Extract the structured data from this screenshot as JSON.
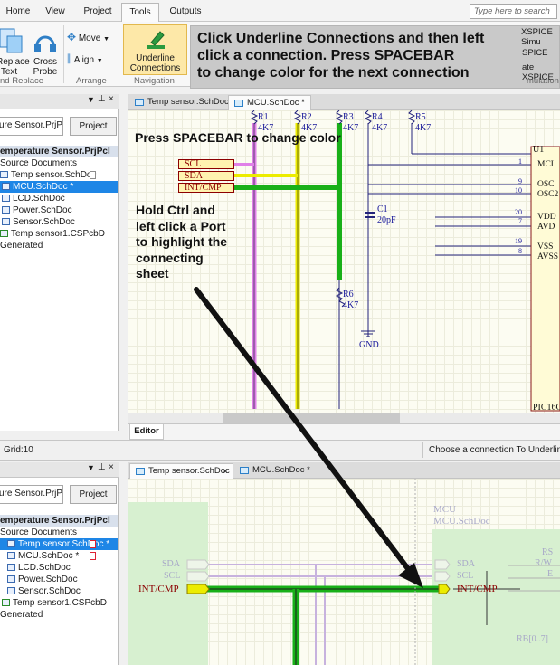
{
  "ribbon": {
    "tabs": [
      "Home",
      "View",
      "Project",
      "Tools",
      "Outputs"
    ],
    "active_tab": "Tools",
    "search_placeholder": "Type here to search",
    "buttons": {
      "replace_text": "Replace Text",
      "cross_probe": "Cross Probe",
      "move": "Move",
      "align": "Align",
      "underline_connections": "Underline Connections",
      "xspice_sim": "XSPICE Simu",
      "xspice_line2": "SPICE",
      "xspice_line3": "ate XSPICE"
    },
    "groups": {
      "find_replace": "nd Replace",
      "arrange": "Arrange",
      "navigation": "Navigation",
      "simulation": "mulation"
    }
  },
  "callout": {
    "line1": "Click Underline Connections and then left",
    "line2": "click a connection. Press SPACEBAR",
    "line3": "to change color for the next connection"
  },
  "top_panel": {
    "project_field": "ure Sensor.PrjPcb",
    "project_button": "Project",
    "tree": {
      "root": "emperature Sensor.PrjPcl",
      "source_docs": "Source Documents",
      "items": [
        "Temp sensor.SchDoc",
        "MCU.SchDoc *",
        "LCD.SchDoc",
        "Power.SchDoc",
        "Sensor.SchDoc",
        "Temp sensor1.CSPcbD",
        "Generated"
      ]
    }
  },
  "top_editor": {
    "tabs": [
      "Temp sensor.SchDoc",
      "MCU.SchDoc *"
    ],
    "editor_label": "Editor",
    "resistors": [
      "R1",
      "R2",
      "R3",
      "R4",
      "R5",
      "R6"
    ],
    "resistor_value": "4K7",
    "ports": [
      "SCL",
      "SDA",
      "INT/CMP"
    ],
    "cap_ref": "C1",
    "cap_value": "20pF",
    "gnd": "GND",
    "ic_ref": "U1",
    "ic_part": "PIC16C",
    "ic_pins": [
      {
        "num": "1",
        "name": "MCL"
      },
      {
        "num": "9",
        "name": "OSC"
      },
      {
        "num": "10",
        "name": "OSC2"
      },
      {
        "num": "20",
        "name": "VDD"
      },
      {
        "num": "7",
        "name": "AVD"
      },
      {
        "num": "19",
        "name": "VSS"
      },
      {
        "num": "8",
        "name": "AVSS"
      }
    ],
    "note_spacebar": "Press SPACEBAR to change color",
    "note_ctrl": [
      "Hold Ctrl and",
      "left click a Port",
      "to highlight the",
      "connecting",
      "sheet"
    ]
  },
  "status": {
    "grid": "Grid:10",
    "message": "Choose a connection To Underline"
  },
  "bottom_panel": {
    "project_field": "ure Sensor.PrjPcb",
    "project_button": "Project",
    "tree": {
      "root": "emperature Sensor.PrjPcl",
      "source_docs": "Source Documents",
      "items": [
        "Temp sensor.SchDoc *",
        "MCU.SchDoc *",
        "LCD.SchDoc",
        "Power.SchDoc",
        "Sensor.SchDoc",
        "Temp sensor1.CSPcbD",
        "Generated"
      ]
    }
  },
  "bottom_editor": {
    "tabs": [
      "Temp sensor.SchDoc",
      "MCU.SchDoc *"
    ],
    "left_ports": [
      "SDA",
      "SCL",
      "INT/CMP"
    ],
    "sheet_name": "MCU",
    "sheet_file": "MCU.SchDoc",
    "sheet_ports": [
      "SDA",
      "SCL",
      "INT/CMP"
    ],
    "right_pins": [
      "RS",
      "R/W",
      "E",
      "RB[0..7]"
    ]
  }
}
